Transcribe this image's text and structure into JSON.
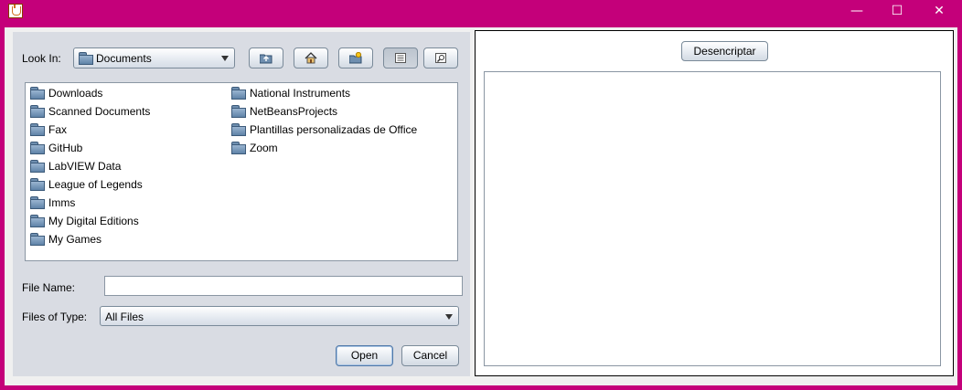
{
  "window": {
    "minimize_glyph": "—",
    "maximize_glyph": "☐",
    "close_glyph": "✕",
    "accent_color": "#c4007a"
  },
  "chooser": {
    "look_in_label": "Look In:",
    "look_in_value": "Documents",
    "toolbar_icons": [
      "up-one-level-icon",
      "home-icon",
      "new-folder-icon",
      "list-view-icon",
      "details-view-icon"
    ],
    "files_left": [
      "Downloads",
      "Scanned Documents",
      "Fax",
      "GitHub",
      "LabVIEW Data",
      "League of Legends",
      "Imms",
      "My Digital Editions",
      "My Games"
    ],
    "files_right": [
      "National Instruments",
      "NetBeansProjects",
      "Plantillas personalizadas de Office",
      "Zoom"
    ],
    "file_name_label": "File Name:",
    "file_name_value": "",
    "files_of_type_label": "Files of Type:",
    "files_of_type_value": "All Files",
    "open_label": "Open",
    "cancel_label": "Cancel"
  },
  "right_panel": {
    "decrypt_label": "Desencriptar",
    "output_text": ""
  }
}
